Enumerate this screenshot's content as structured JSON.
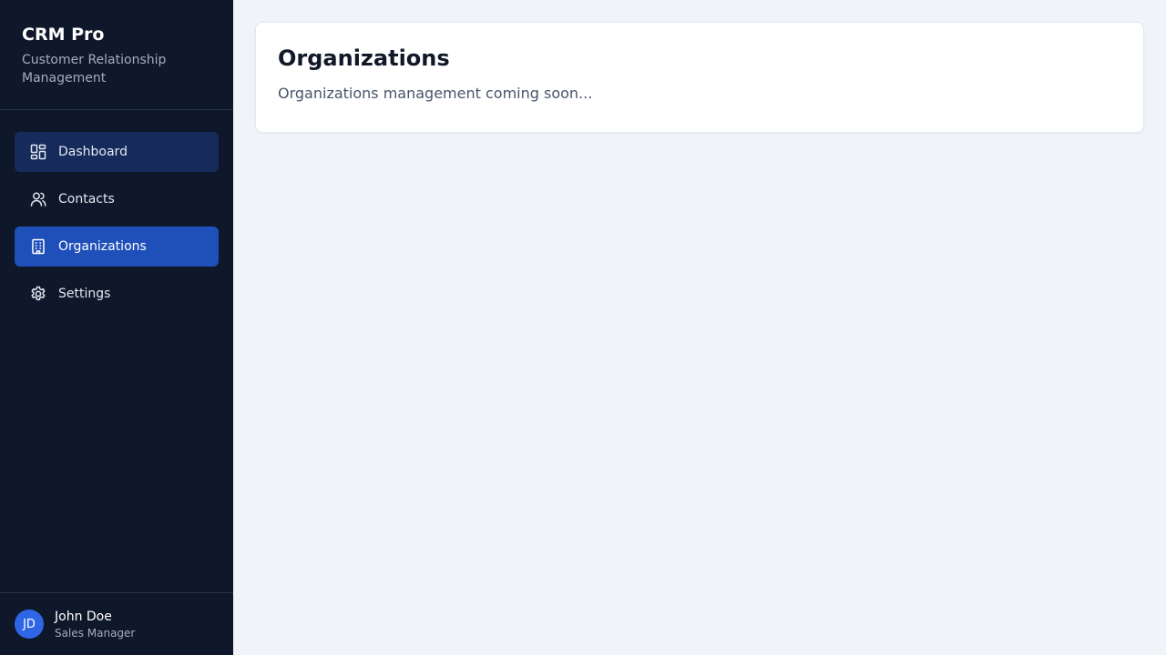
{
  "brand": {
    "title": "CRM Pro",
    "subtitle": "Customer Relationship Management"
  },
  "nav": {
    "items": [
      {
        "label": "Dashboard",
        "icon": "dashboard-icon"
      },
      {
        "label": "Contacts",
        "icon": "users-icon"
      },
      {
        "label": "Organizations",
        "icon": "building-icon",
        "active": true
      },
      {
        "label": "Settings",
        "icon": "gear-icon"
      }
    ]
  },
  "user": {
    "initials": "JD",
    "name": "John Doe",
    "role": "Sales Manager"
  },
  "main": {
    "title": "Organizations",
    "description": "Organizations management coming soon..."
  },
  "colors": {
    "sidebar_bg": "#0f172a",
    "active_nav": "#1f4fb9",
    "avatar": "#2f66e6",
    "page_bg": "#f0f3f8"
  }
}
